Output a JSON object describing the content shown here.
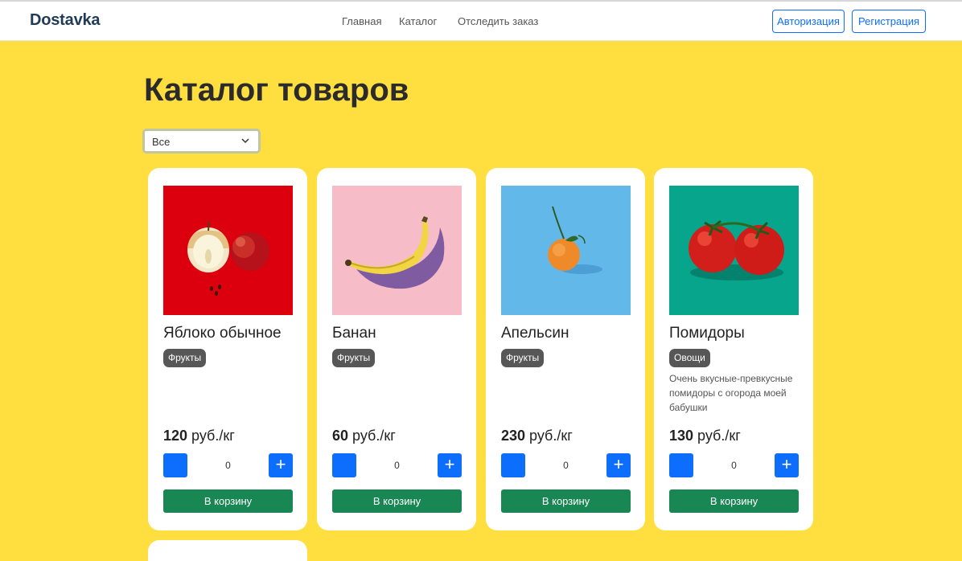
{
  "header": {
    "brand": "Dostavka",
    "nav": [
      "Главная",
      "Каталог",
      "Отследить заказ"
    ],
    "login_label": "Авторизация",
    "register_label": "Регистрация"
  },
  "page_title": "Каталог товаров",
  "filter": {
    "selected": "Все"
  },
  "products": [
    {
      "name": "Яблоко обычное",
      "category": "Фрукты",
      "description": "",
      "price": "120",
      "unit": " руб./кг",
      "qty": "0",
      "plus": "+",
      "cart_label": "В корзину",
      "image": "apple-photo"
    },
    {
      "name": "Банан",
      "category": "Фрукты",
      "description": "",
      "price": "60",
      "unit": " руб./кг",
      "qty": "0",
      "plus": "+",
      "cart_label": "В корзину",
      "image": "banana-photo"
    },
    {
      "name": "Апельсин",
      "category": "Фрукты",
      "description": "",
      "price": "230",
      "unit": " руб./кг",
      "qty": "0",
      "plus": "+",
      "cart_label": "В корзину",
      "image": "orange-photo"
    },
    {
      "name": "Помидоры",
      "category": "Овощи",
      "description": "Очень вкусные-превкусные помидоры с огорода моей бабушки",
      "price": "130",
      "unit": " руб./кг",
      "qty": "0",
      "plus": "+",
      "cart_label": "В корзину",
      "image": "tomato-photo"
    }
  ],
  "colors": {
    "page_bg": "#ffdf40",
    "brand": "#1f3b57",
    "primary": "#0d6efd",
    "success": "#198754",
    "badge": "#575757"
  }
}
